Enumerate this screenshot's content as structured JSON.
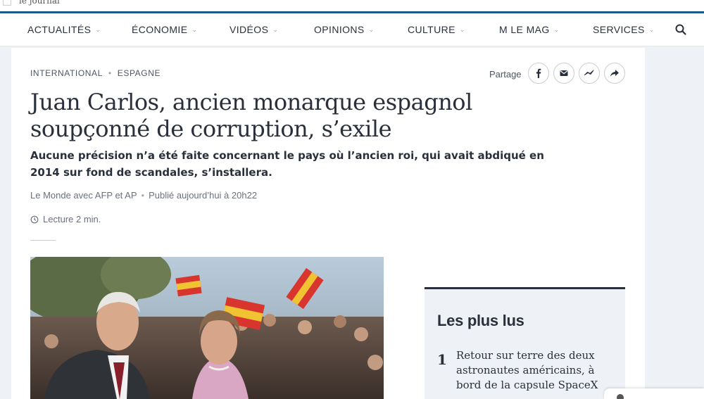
{
  "browser": {
    "brand": "le journal"
  },
  "nav": {
    "items": [
      {
        "label": "ACTUALITÉS",
        "dropdown": true
      },
      {
        "label": "ÉCONOMIE",
        "dropdown": true
      },
      {
        "label": "VIDÉOS",
        "dropdown": true
      },
      {
        "label": "OPINIONS",
        "dropdown": true
      },
      {
        "label": "CULTURE",
        "dropdown": true
      },
      {
        "label": "M LE MAG",
        "dropdown": true
      },
      {
        "label": "SERVICES",
        "dropdown": true
      }
    ],
    "search_icon": "search-icon"
  },
  "article": {
    "breadcrumb": [
      "INTERNATIONAL",
      "ESPAGNE"
    ],
    "share_label": "Partage",
    "share_icons": [
      "facebook-icon",
      "email-icon",
      "messenger-icon",
      "share-arrow-icon"
    ],
    "title_line1": "Juan Carlos, ancien monarque espagnol",
    "title_line2": "soupçonné de corruption, s’exile",
    "description": "Aucune précision n’a été faite concernant le pays où l’ancien roi, qui avait abdiqué en 2014 sur fond de scandales, s’installera.",
    "author": "Le Monde avec AFP et AP",
    "published": "Publié aujourd’hui à 20h22",
    "reading_time": "Lecture 2 min."
  },
  "most_read": {
    "title": "Les plus lus",
    "items": [
      {
        "rank": "1",
        "text": "Retour sur terre des deux astronautes américains, à bord de la capsule SpaceX"
      }
    ]
  },
  "colors": {
    "accent": "#1a5a8a",
    "text": "#2a303b",
    "panel": "#eef1f5"
  }
}
